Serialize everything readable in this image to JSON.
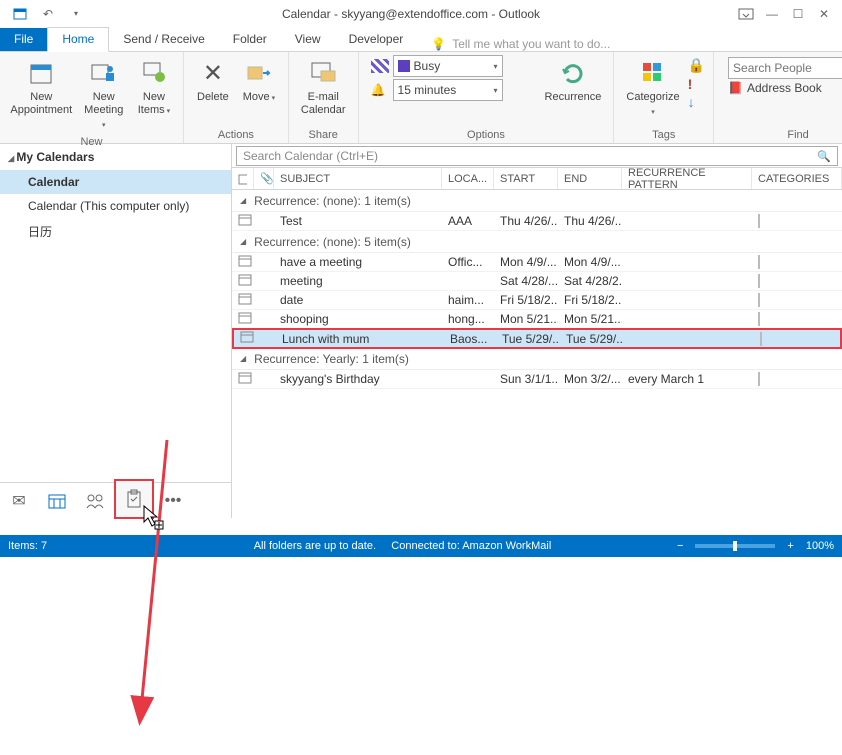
{
  "window": {
    "title": "Calendar - skyyang@extendoffice.com - Outlook"
  },
  "tabs": {
    "file": "File",
    "home": "Home",
    "sendrec": "Send / Receive",
    "folder": "Folder",
    "view": "View",
    "developer": "Developer",
    "tellme": "Tell me what you want to do..."
  },
  "ribbon": {
    "new_appointment": "New\nAppointment",
    "new_meeting": "New\nMeeting",
    "new_items": "New\nItems",
    "delete": "Delete",
    "move": "Move",
    "email_calendar": "E-mail\nCalendar",
    "recurrence": "Recurrence",
    "categorize": "Categorize",
    "busy": "Busy",
    "reminder": "15 minutes",
    "search_people_ph": "Search People",
    "address_book": "Address Book",
    "groups": {
      "new": "New",
      "actions": "Actions",
      "share": "Share",
      "options": "Options",
      "tags": "Tags",
      "find": "Find"
    }
  },
  "nav": {
    "header": "My Calendars",
    "items": [
      "Calendar",
      "Calendar (This computer only)",
      "日历"
    ]
  },
  "search_ph": "Search Calendar (Ctrl+E)",
  "columns": {
    "subject": "SUBJECT",
    "loca": "LOCA...",
    "start": "START",
    "end": "END",
    "recur": "RECURRENCE PATTERN",
    "cat": "CATEGORIES"
  },
  "groups": [
    {
      "label": "Recurrence: (none): 1 item(s)",
      "rows": [
        {
          "subject": "Test",
          "loca": "AAA",
          "start": "Thu 4/26/...",
          "end": "Thu 4/26/...",
          "recur": ""
        }
      ]
    },
    {
      "label": "Recurrence: (none): 5 item(s)",
      "rows": [
        {
          "subject": "have a meeting",
          "loca": "Offic...",
          "start": "Mon 4/9/...",
          "end": "Mon 4/9/...",
          "recur": ""
        },
        {
          "subject": "meeting",
          "loca": "",
          "start": "Sat 4/28/...",
          "end": "Sat 4/28/2...",
          "recur": ""
        },
        {
          "subject": "date",
          "loca": "haim...",
          "start": "Fri 5/18/2...",
          "end": "Fri 5/18/2...",
          "recur": ""
        },
        {
          "subject": "shooping",
          "loca": "hong...",
          "start": "Mon 5/21...",
          "end": "Mon 5/21...",
          "recur": ""
        },
        {
          "subject": "Lunch with mum",
          "loca": "Baos...",
          "start": "Tue 5/29/...",
          "end": "Tue 5/29/...",
          "recur": "",
          "selected": true
        }
      ]
    },
    {
      "label": "Recurrence: Yearly: 1 item(s)",
      "rows": [
        {
          "subject": "skyyang's Birthday",
          "loca": "",
          "start": "Sun 3/1/1...",
          "end": "Mon 3/2/...",
          "recur": "every March 1"
        }
      ]
    }
  ],
  "status": {
    "items": "Items: 7",
    "sync": "All folders are up to date.",
    "conn": "Connected to: Amazon WorkMail",
    "zoom": "100%"
  }
}
